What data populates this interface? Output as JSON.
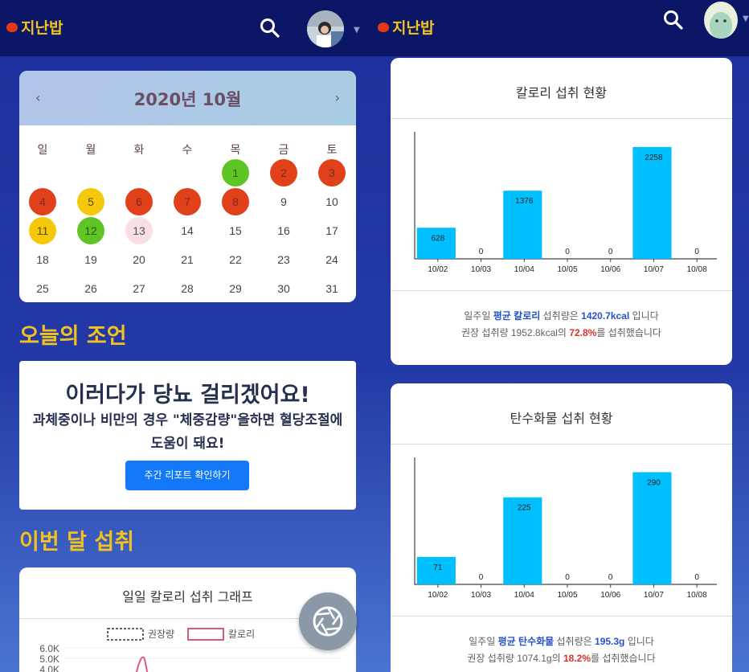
{
  "app": {
    "logo_text": "지난밥"
  },
  "calendar": {
    "title": "2020년 10월",
    "prev": "‹",
    "next": "›",
    "weekdays": [
      "일",
      "월",
      "화",
      "수",
      "목",
      "금",
      "토"
    ],
    "days": [
      {
        "n": "1",
        "status": "green"
      },
      {
        "n": "2",
        "status": "red"
      },
      {
        "n": "3",
        "status": "red"
      },
      {
        "n": "4",
        "status": "red"
      },
      {
        "n": "5",
        "status": "yellow"
      },
      {
        "n": "6",
        "status": "red"
      },
      {
        "n": "7",
        "status": "red"
      },
      {
        "n": "8",
        "status": "red"
      },
      {
        "n": "9",
        "status": ""
      },
      {
        "n": "10",
        "status": ""
      },
      {
        "n": "11",
        "status": "yellow"
      },
      {
        "n": "12",
        "status": "green"
      },
      {
        "n": "13",
        "status": "pink"
      },
      {
        "n": "14",
        "status": ""
      },
      {
        "n": "15",
        "status": ""
      },
      {
        "n": "16",
        "status": ""
      },
      {
        "n": "17",
        "status": ""
      },
      {
        "n": "18",
        "status": ""
      },
      {
        "n": "19",
        "status": ""
      },
      {
        "n": "20",
        "status": ""
      },
      {
        "n": "21",
        "status": ""
      },
      {
        "n": "22",
        "status": ""
      },
      {
        "n": "23",
        "status": ""
      },
      {
        "n": "24",
        "status": ""
      },
      {
        "n": "25",
        "status": ""
      },
      {
        "n": "26",
        "status": ""
      },
      {
        "n": "27",
        "status": ""
      },
      {
        "n": "28",
        "status": ""
      },
      {
        "n": "29",
        "status": ""
      },
      {
        "n": "30",
        "status": ""
      },
      {
        "n": "31",
        "status": ""
      }
    ],
    "first_weekday": 4
  },
  "advice": {
    "section_title": "오늘의 조언",
    "headline": "이러다가 당뇨 걸리겠어요!",
    "body": "과체중이나 비만의 경우 \"체중감량\"을하면 혈당조절에 도움이 돼요!",
    "button": "주간 리포트 확인하기"
  },
  "monthly": {
    "section_title": "이번 달 섭취",
    "graph_title": "일일 칼로리 섭취 그래프",
    "legend": [
      "권장량",
      "칼로리"
    ],
    "y_ticks": [
      "6.0K",
      "5.0K",
      "4.0K"
    ]
  },
  "calorie_card": {
    "title": "칼로리 섭취 현황",
    "summary_line1_pre": "일주일 ",
    "summary_line1_hl": "평균 칼로리",
    "summary_line1_mid": " 섭취량은 ",
    "summary_line1_val": "1420.7kcal",
    "summary_line1_post": " 입니다",
    "summary_line2_pre": "권장 섭취량 1952.8kcal의 ",
    "summary_line2_val": "72.8%",
    "summary_line2_post": "를 섭취했습니다"
  },
  "carb_card": {
    "title": "탄수화물 섭취 현황",
    "summary_line1_pre": "일주일 ",
    "summary_line1_hl": "평균 탄수화물",
    "summary_line1_mid": " 섭취량은 ",
    "summary_line1_val": "195.3g",
    "summary_line1_post": " 입니다",
    "summary_line2_pre": "권장 섭취량 1074.1g의 ",
    "summary_line2_val": "18.2%",
    "summary_line2_post": "를 섭취했습니다"
  },
  "colors": {
    "bar": "#00bfff",
    "header": "#0c1666",
    "accent": "#f4c21f"
  },
  "chart_data": [
    {
      "type": "bar",
      "title": "칼로리 섭취 현황",
      "categories": [
        "10/02",
        "10/03",
        "10/04",
        "10/05",
        "10/06",
        "10/07",
        "10/08"
      ],
      "values": [
        628,
        0,
        1376,
        0,
        0,
        2258,
        0
      ],
      "ylim": [
        0,
        2500
      ]
    },
    {
      "type": "bar",
      "title": "탄수화물 섭취 현황",
      "categories": [
        "10/02",
        "10/03",
        "10/04",
        "10/05",
        "10/06",
        "10/07",
        "10/08"
      ],
      "values": [
        71,
        0,
        225,
        0,
        0,
        290,
        0
      ],
      "ylim": [
        0,
        320
      ]
    }
  ]
}
